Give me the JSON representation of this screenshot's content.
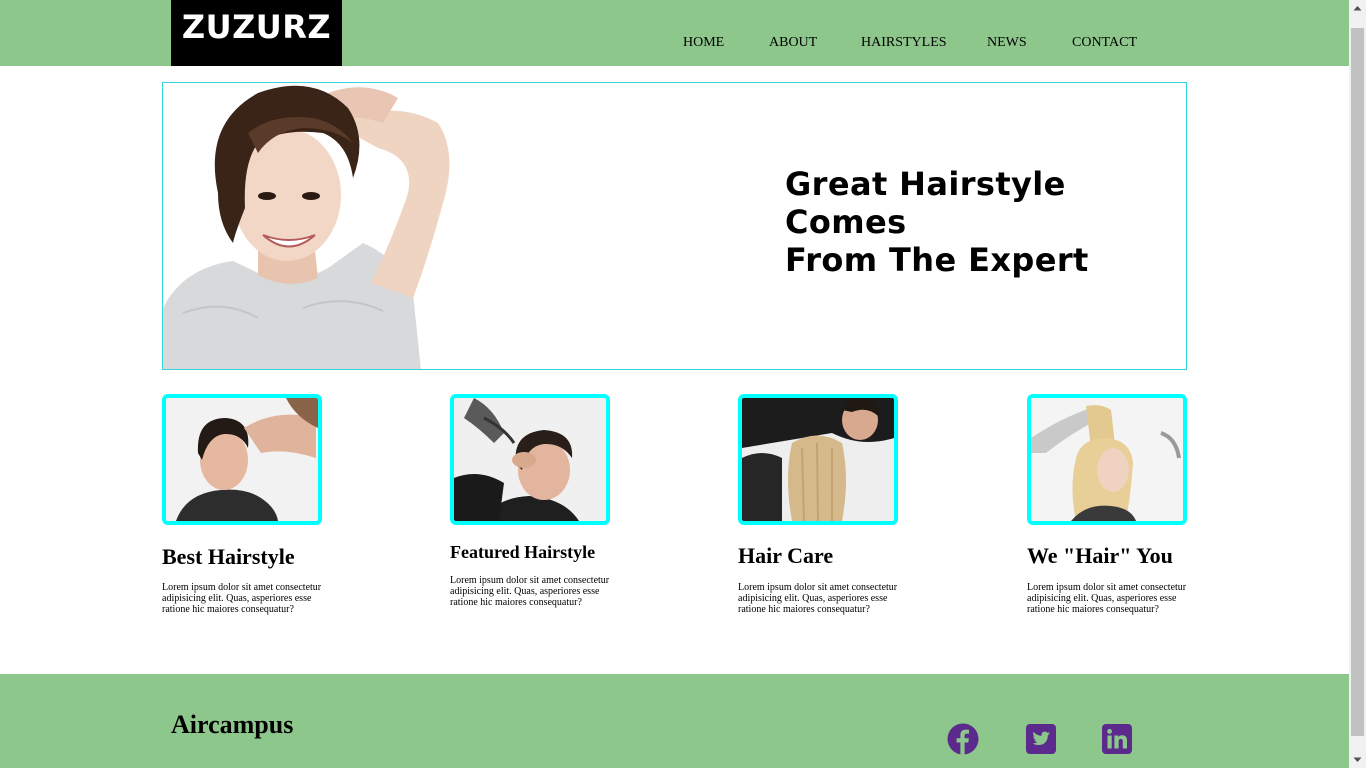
{
  "header": {
    "logo": "ZUZURZ",
    "nav": [
      "HOME",
      "ABOUT",
      "HAIRSTYLES",
      "NEWS",
      "CONTACT"
    ]
  },
  "hero": {
    "title_line1": "Great Hairstyle Comes",
    "title_line2": "From The Expert"
  },
  "cards": [
    {
      "title": "Best Hairstyle",
      "text": "Lorem ipsum dolor sit amet consectetur adipisicing elit. Quas, asperiores esse ratione hic maiores consequatur?"
    },
    {
      "title": "Featured Hairstyle",
      "text": "Lorem ipsum dolor sit amet consectetur adipisicing elit. Quas, asperiores esse ratione hic maiores consequatur?"
    },
    {
      "title": "Hair Care",
      "text": "Lorem ipsum dolor sit amet consectetur adipisicing elit. Quas, asperiores esse ratione hic maiores consequatur?"
    },
    {
      "title": "We \"Hair\" You",
      "text": "Lorem ipsum dolor sit amet consectetur adipisicing elit. Quas, asperiores esse ratione hic maiores consequatur?"
    }
  ],
  "footer": {
    "brand": "Aircampus",
    "social_icons": [
      "facebook-icon",
      "twitter-icon",
      "linkedin-icon"
    ]
  },
  "colors": {
    "header_bg": "#8dc78c",
    "logo_bg": "#000000",
    "card_border": "#00ffff",
    "hero_border": "#33d6e0",
    "social_icon": "#5b2a8c"
  }
}
